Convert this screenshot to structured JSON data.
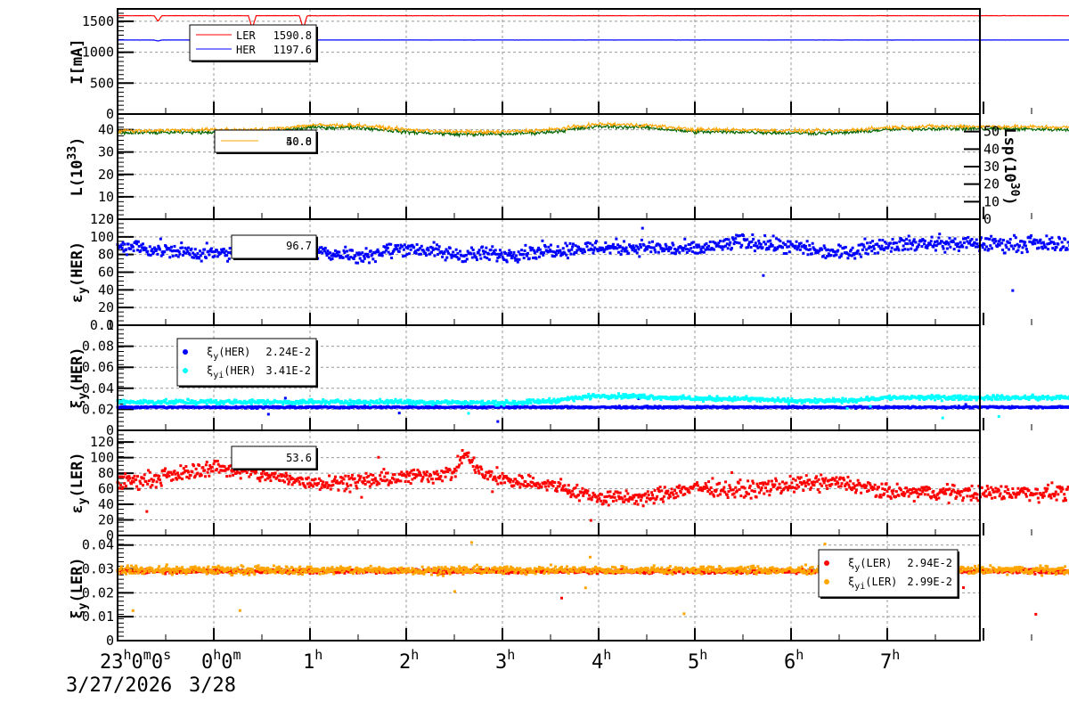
{
  "chart_data": [
    {
      "type": "line",
      "id": "current",
      "ylabel": "I[mA]",
      "ylim": [
        0,
        1700
      ],
      "yticks": [
        0,
        500,
        1000,
        1500
      ],
      "series": [
        {
          "name": "LER",
          "color": "#ff0000",
          "base": 1590,
          "noise": 6,
          "dips": [
            [
              -0.58,
              1500
            ],
            [
              0.4,
              1380
            ],
            [
              0.93,
              1380
            ]
          ],
          "legend_value": "1590.8"
        },
        {
          "name": "HER",
          "color": "#0000ff",
          "base": 1197,
          "noise": 2,
          "dips": [
            [
              -0.58,
              1180
            ],
            [
              0.4,
              1140
            ],
            [
              0.95,
              1140
            ]
          ],
          "legend_value": "1197.6"
        }
      ]
    },
    {
      "type": "line",
      "id": "luminosity",
      "ylabel": "L(10",
      "ylabel_sup": "33",
      "ylabel_end": ")",
      "ylim": [
        0,
        47
      ],
      "yticks": [
        0,
        10,
        20,
        30,
        40
      ],
      "y2label": "Lsp(10",
      "y2label_sup": "30",
      "y2label_end": ")",
      "y2lim": [
        0,
        60
      ],
      "y2ticks": [
        0,
        10,
        20,
        30,
        40,
        50
      ],
      "t": [
        -1,
        0,
        0.5,
        1,
        1.5,
        2,
        2.5,
        3,
        3.5,
        4,
        4.5,
        5,
        5.5,
        6,
        6.5,
        7,
        7.5,
        8,
        9
      ],
      "series": [
        {
          "name": "green",
          "color": "#006400",
          "values": [
            38.5,
            39,
            39,
            41,
            41,
            39,
            38,
            38,
            39,
            41.5,
            41,
            39,
            39,
            38.5,
            38.5,
            40,
            40.5,
            40.5,
            40
          ],
          "noise": 0.6
        },
        {
          "name": "orange",
          "color": "#ffa500",
          "values": [
            39.5,
            40,
            40,
            42,
            42,
            40,
            39,
            39,
            40,
            42.5,
            42,
            40,
            40,
            39.5,
            39.5,
            41,
            41.5,
            41.5,
            41
          ],
          "noise": 0.6
        }
      ],
      "legend_values": [
        "40.8",
        "50.0"
      ]
    },
    {
      "type": "scatter",
      "id": "emit_her",
      "ylabel": "ε",
      "ylabel_sub": "y",
      "ylabel_end": "(HER)",
      "ylim": [
        0,
        120
      ],
      "yticks": [
        0,
        20,
        40,
        60,
        80,
        100,
        120
      ],
      "t": [
        -1,
        -0.5,
        0,
        0.5,
        1,
        1.5,
        2,
        2.5,
        3,
        3.5,
        4,
        4.5,
        5,
        5.5,
        6,
        6.5,
        7,
        7.5,
        8,
        8.5,
        9
      ],
      "series": [
        {
          "name": "HER",
          "color": "#0000ff",
          "values": [
            90,
            85,
            80,
            85,
            85,
            78,
            88,
            80,
            80,
            85,
            88,
            88,
            85,
            95,
            88,
            82,
            92,
            92,
            92,
            92,
            92
          ],
          "noise": 6
        }
      ],
      "legend_values": [
        "96.7"
      ]
    },
    {
      "type": "scatter",
      "id": "tune_her",
      "ylabel": "ξ",
      "ylabel_sub": "y",
      "ylabel_end": "(HER)",
      "ylim": [
        0,
        0.1
      ],
      "yticks": [
        "0",
        "0.02",
        "0.04",
        "0.06",
        "0.08",
        "0.1"
      ],
      "t": [
        -1,
        0,
        1,
        2,
        3,
        3.5,
        4,
        4.5,
        5,
        5.5,
        6,
        6.5,
        7,
        8,
        9
      ],
      "series": [
        {
          "name": "ξ",
          "sub": "y",
          "tail": "(HER)",
          "value": "2.24E-2",
          "color": "#0000ff",
          "values": [
            0.022,
            0.022,
            0.022,
            0.022,
            0.022,
            0.022,
            0.022,
            0.022,
            0.022,
            0.022,
            0.022,
            0.022,
            0.022,
            0.022,
            0.022
          ],
          "noise": 0.0006
        },
        {
          "name": "ξ",
          "sub": "yi",
          "tail": "(HER)",
          "value": "3.41E-2",
          "color": "#00ffff",
          "values": [
            0.027,
            0.027,
            0.027,
            0.027,
            0.026,
            0.028,
            0.033,
            0.032,
            0.03,
            0.03,
            0.028,
            0.028,
            0.031,
            0.031,
            0.031
          ],
          "noise": 0.0015
        }
      ]
    },
    {
      "type": "scatter",
      "id": "emit_ler",
      "ylabel": "ε",
      "ylabel_sub": "y",
      "ylabel_end": "(LER)",
      "ylim": [
        0,
        135
      ],
      "yticks": [
        0,
        20,
        40,
        60,
        80,
        100,
        120
      ],
      "t": [
        -1,
        -0.5,
        0,
        0.5,
        1,
        1.5,
        2,
        2.5,
        2.6,
        2.8,
        3,
        3.5,
        4,
        4.5,
        5,
        5.5,
        6,
        6.5,
        7,
        7.5,
        8,
        9
      ],
      "series": [
        {
          "name": "LER",
          "color": "#ff0000",
          "values": [
            68,
            75,
            88,
            78,
            68,
            70,
            75,
            80,
            105,
            78,
            72,
            65,
            48,
            48,
            62,
            58,
            65,
            68,
            55,
            55,
            55,
            55
          ],
          "noise": 7
        }
      ],
      "legend_values": [
        "53.6"
      ]
    },
    {
      "type": "scatter",
      "id": "tune_ler",
      "ylabel": "ξ",
      "ylabel_sub": "y",
      "ylabel_end": "(LER)",
      "ylim": [
        0,
        0.044
      ],
      "yticks": [
        "0",
        "0.01",
        "0.02",
        "0.03",
        "0.04"
      ],
      "t": [
        -1,
        9
      ],
      "series": [
        {
          "name": "ξ",
          "sub": "y",
          "tail": "(LER)",
          "value": "2.94E-2",
          "color": "#ff0000",
          "values": [
            0.029,
            0.029
          ],
          "noise": 0.0006
        },
        {
          "name": "ξ",
          "sub": "yi",
          "tail": "(LER)",
          "value": "2.99E-2",
          "color": "#ffa500",
          "values": [
            0.0295,
            0.0295
          ],
          "noise": 0.0012
        }
      ]
    }
  ],
  "xaxis": {
    "range_hours": [
      -1,
      8.96
    ],
    "labels": [
      {
        "t": -1,
        "main": "23",
        "parts": [
          [
            "h",
            "0"
          ],
          [
            "m",
            "0"
          ],
          [
            "s",
            ""
          ]
        ]
      },
      {
        "t": 0,
        "main": "0",
        "parts": [
          [
            "h",
            "0"
          ],
          [
            "m",
            ""
          ]
        ]
      },
      {
        "t": 1,
        "main": "1",
        "parts": [
          [
            "h",
            ""
          ]
        ]
      },
      {
        "t": 2,
        "main": "2",
        "parts": [
          [
            "h",
            ""
          ]
        ]
      },
      {
        "t": 3,
        "main": "3",
        "parts": [
          [
            "h",
            ""
          ]
        ]
      },
      {
        "t": 4,
        "main": "4",
        "parts": [
          [
            "h",
            ""
          ]
        ]
      },
      {
        "t": 5,
        "main": "5",
        "parts": [
          [
            "h",
            ""
          ]
        ]
      },
      {
        "t": 6,
        "main": "6",
        "parts": [
          [
            "h",
            ""
          ]
        ]
      },
      {
        "t": 7,
        "main": "7",
        "parts": [
          [
            "h",
            ""
          ]
        ]
      }
    ],
    "date1": "3/27/2026",
    "date2": "3/28"
  }
}
